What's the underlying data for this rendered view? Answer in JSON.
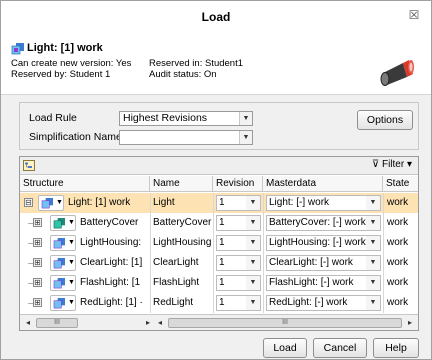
{
  "window": {
    "title": "Load",
    "close_glyph": "☒"
  },
  "header": {
    "title": "Light: [1] work",
    "can_create": "Can create new version: Yes",
    "reserved_in": "Reserved in: Student1",
    "reserved_by": "Reserved by: Student 1",
    "audit_status": "Audit status: On"
  },
  "load_rule": {
    "label": "Load Rule",
    "value": "Highest Revisions"
  },
  "simplification": {
    "label": "Simplification Name",
    "value": ""
  },
  "options_label": "Options",
  "filter_label": "Filter ▾",
  "columns": [
    "Structure",
    "Name",
    "Revision",
    "Masterdata",
    "State"
  ],
  "rows": [
    {
      "structure": "Light: [1] work",
      "name": "Light",
      "revision": "1",
      "masterdata": "Light: [-] work",
      "state": "work",
      "expand": "⊟"
    },
    {
      "structure": "BatteryCover",
      "name": "BatteryCover",
      "revision": "1",
      "masterdata": "BatteryCover: [-] work",
      "state": "work",
      "expand": "⊞"
    },
    {
      "structure": "LightHousing:",
      "name": "LightHousing",
      "revision": "1",
      "masterdata": "LightHousing: [-] work",
      "state": "work",
      "expand": "⊞"
    },
    {
      "structure": "ClearLight: [1]",
      "name": "ClearLight",
      "revision": "1",
      "masterdata": "ClearLight: [-] work",
      "state": "work",
      "expand": "⊞"
    },
    {
      "structure": "FlashLight: [1",
      "name": "FlashLight",
      "revision": "1",
      "masterdata": "FlashLight: [-] work",
      "state": "work",
      "expand": "⊞"
    },
    {
      "structure": "RedLight: [1] ·",
      "name": "RedLight",
      "revision": "1",
      "masterdata": "RedLight: [-] work",
      "state": "work",
      "expand": "⊞"
    }
  ],
  "buttons": {
    "load": "Load",
    "cancel": "Cancel",
    "help": "Help"
  },
  "scrollbar_thumb": "III"
}
